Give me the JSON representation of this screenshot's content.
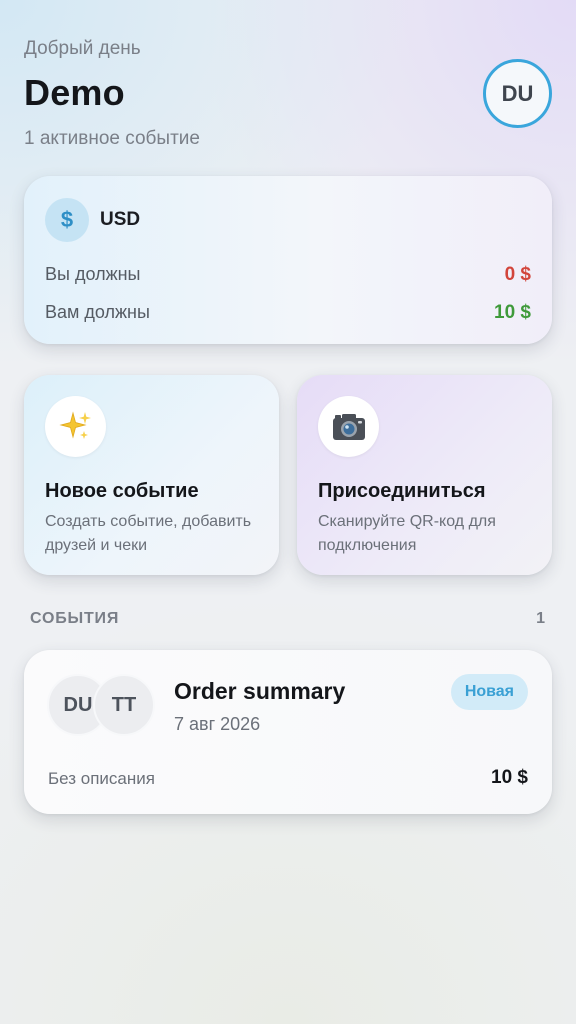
{
  "header": {
    "greeting": "Добрый день",
    "username": "Demo",
    "active_events": "1 активное событие",
    "avatar_initials": "DU"
  },
  "balance": {
    "currency_symbol": "$",
    "currency_code": "USD",
    "you_owe_label": "Вы должны",
    "you_owe_value": "0 $",
    "owed_to_you_label": "Вам должны",
    "owed_to_you_value": "10 $",
    "colors": {
      "owe": "#d2453b",
      "owed": "#3f9a3a"
    }
  },
  "actions": [
    {
      "icon": "sparkles-icon",
      "glyph": "✨",
      "title": "Новое событие",
      "subtitle": "Создать событие, добавить друзей и чеки"
    },
    {
      "icon": "camera-icon",
      "glyph": "📷",
      "title": "Присоединиться",
      "subtitle": "Сканируйте QR-код для подключения"
    }
  ],
  "events_section": {
    "title": "СОБЫТИЯ",
    "count": "1"
  },
  "events": [
    {
      "participants": [
        "DU",
        "TT"
      ],
      "title": "Order summary",
      "date": "7 авг 2026",
      "badge": "Новая",
      "description": "Без описания",
      "amount": "10 $"
    }
  ],
  "accent_color": "#3aa6dc"
}
